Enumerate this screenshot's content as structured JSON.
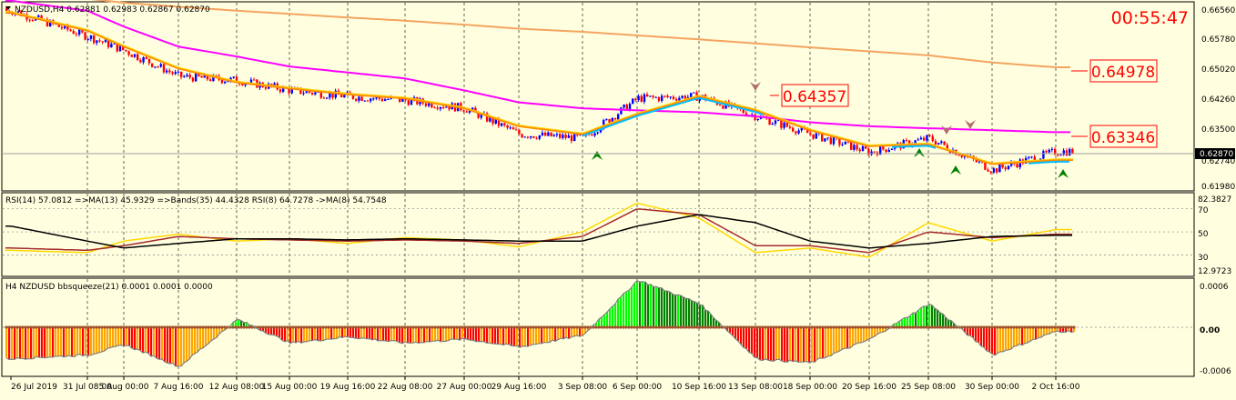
{
  "main_chart": {
    "header": "NZDUSD,H4  0.62881 0.62983 0.62867 0.62870",
    "timer": "00:55:47",
    "price_ticks": [
      "0.66560",
      "0.65780",
      "0.65020",
      "0.64260",
      "0.63500",
      "0.62740",
      "0.61980"
    ],
    "current_price": "0.62870",
    "price_labels": [
      "0.64978",
      "0.64357",
      "0.63346"
    ]
  },
  "rsi_panel": {
    "header": "RSI(14) 57.0812  =>MA(13) 45.9329  =>Bands(35) 44.4328  RSI(8) 64.7278  ->MA(8) 54.7548",
    "ticks": [
      "82.3827",
      "70",
      "50",
      "30",
      "12.9723"
    ]
  },
  "squeeze_panel": {
    "header": "H4 NZDUSD bbsqueeze(21) 0.0001 0.0001 0.0000",
    "ticks": [
      "0.0006",
      "0.00",
      "-0.0006"
    ]
  },
  "time_axis": {
    "labels": [
      "26 Jul 2019",
      "31 Jul 08:00",
      "5 Aug 00:00",
      "7 Aug 16:00",
      "12 Aug 08:00",
      "15 Aug 00:00",
      "19 Aug 16:00",
      "22 Aug 08:00",
      "27 Aug 00:00",
      "29 Aug 16:00",
      "3 Sep 08:00",
      "6 Sep 00:00",
      "10 Sep 16:00",
      "13 Sep 08:00",
      "18 Sep 00:00",
      "20 Sep 16:00",
      "25 Sep 08:00",
      "30 Sep 00:00",
      "2 Oct 16:00"
    ]
  },
  "colors": {
    "background": "#FFFFE0",
    "bull_candle": "#0000FF",
    "bear_candle": "#FF0000",
    "ma_fast": "#FF8C00",
    "ma_signal": "#FFD700",
    "ma_aqua": "#00BFFF",
    "ma_magenta": "#FF00FF",
    "ma_long": "#F4A460",
    "rsi_line": "#FFD700",
    "rsi_ma": "#A52A2A",
    "rsi_bands": "#000000",
    "squeeze_green_dark": "#008000",
    "squeeze_green_light": "#00FF00",
    "squeeze_red": "#FF0000",
    "squeeze_orange": "#FFA500",
    "label_red": "#FF0000"
  },
  "chart_data": [
    {
      "type": "candlestick",
      "title": "NZDUSD,H4",
      "ylim": [
        0.619,
        0.666
      ],
      "x_range": [
        "26 Jul 2019",
        "2 Oct 16:00"
      ],
      "series": [
        {
          "name": "close",
          "x": [
            "26 Jul 2019",
            "31 Jul 08:00",
            "5 Aug 00:00",
            "7 Aug 16:00",
            "12 Aug 08:00",
            "15 Aug 00:00",
            "19 Aug 16:00",
            "22 Aug 08:00",
            "27 Aug 00:00",
            "29 Aug 16:00",
            "3 Sep 08:00",
            "6 Sep 00:00",
            "10 Sep 16:00",
            "13 Sep 08:00",
            "18 Sep 00:00",
            "20 Sep 16:00",
            "25 Sep 08:00",
            "30 Sep 00:00",
            "2 Oct 16:00"
          ],
          "values": [
            0.664,
            0.6575,
            0.654,
            0.6475,
            0.6465,
            0.644,
            0.6425,
            0.6415,
            0.6395,
            0.633,
            0.632,
            0.642,
            0.6425,
            0.6375,
            0.633,
            0.6285,
            0.632,
            0.624,
            0.6287
          ]
        },
        {
          "name": "MA fast",
          "values": [
            0.6635,
            0.659,
            0.655,
            0.6495,
            0.646,
            0.6445,
            0.643,
            0.642,
            0.6395,
            0.635,
            0.633,
            0.638,
            0.6425,
            0.639,
            0.634,
            0.63,
            0.6305,
            0.6255,
            0.6265
          ]
        },
        {
          "name": "MA magenta",
          "values": [
            0.6665,
            0.664,
            0.66,
            0.655,
            0.6525,
            0.65,
            0.6485,
            0.647,
            0.644,
            0.641,
            0.6395,
            0.639,
            0.6385,
            0.6375,
            0.636,
            0.635,
            0.6345,
            0.634,
            0.6335
          ]
        },
        {
          "name": "MA long",
          "values": [
            0.668,
            0.667,
            0.666,
            0.665,
            0.664,
            0.6632,
            0.6623,
            0.6615,
            0.6605,
            0.6595,
            0.6587,
            0.6578,
            0.6568,
            0.6558,
            0.6548,
            0.6538,
            0.6528,
            0.651,
            0.6498
          ]
        }
      ]
    },
    {
      "type": "line",
      "title": "RSI(14)",
      "ylim": [
        12.9723,
        82.3827
      ],
      "series": [
        {
          "name": "RSI(8)",
          "values": [
            34,
            32,
            42,
            48,
            42,
            44,
            40,
            45,
            43,
            37,
            50,
            75,
            62,
            32,
            36,
            28,
            58,
            42,
            52
          ]
        },
        {
          "name": "MA(8)",
          "values": [
            36,
            34,
            38,
            46,
            44,
            43,
            42,
            43,
            42,
            40,
            46,
            70,
            65,
            38,
            38,
            32,
            50,
            45,
            48
          ]
        },
        {
          "name": "Bands(35)",
          "values": [
            55,
            42,
            36,
            40,
            44,
            44,
            43,
            44,
            43,
            42,
            42,
            55,
            65,
            58,
            42,
            36,
            40,
            46,
            47
          ]
        }
      ]
    },
    {
      "type": "bar",
      "title": "bbsqueeze(21)",
      "ylim": [
        -0.0006,
        0.0006
      ],
      "values": [
        -0.0004,
        -0.00035,
        -0.00022,
        -0.0005,
        0.0001,
        -0.0002,
        -0.00012,
        -0.0002,
        -0.00015,
        -0.00025,
        -0.0001,
        0.0006,
        0.0003,
        -0.0004,
        -0.00045,
        -0.00015,
        0.0003,
        -0.00035,
        -5e-05
      ]
    }
  ]
}
